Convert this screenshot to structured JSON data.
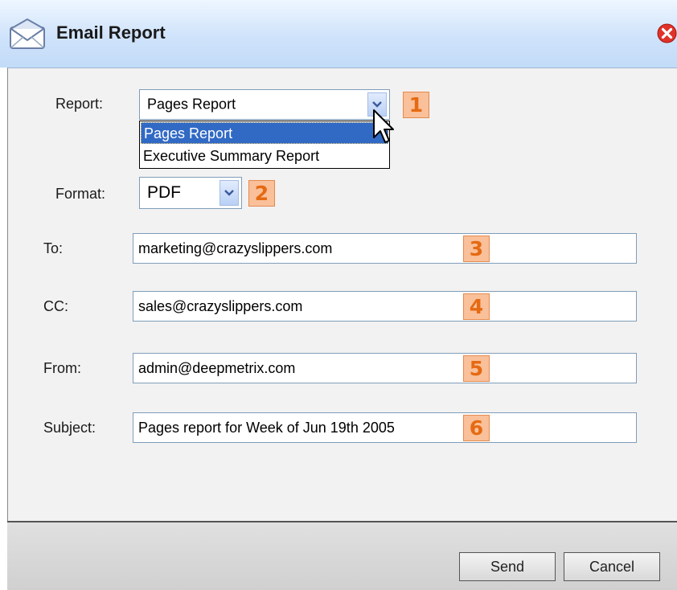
{
  "window": {
    "title": "Email Report"
  },
  "fields": {
    "report": {
      "label": "Report:",
      "value": "Pages Report",
      "options": [
        "Pages Report",
        "Executive Summary Report"
      ],
      "badge": "1"
    },
    "format": {
      "label": "Format:",
      "value": "PDF",
      "badge": "2"
    },
    "to": {
      "label": "To:",
      "value": "marketing@crazyslippers.com",
      "badge": "3"
    },
    "cc": {
      "label": "CC:",
      "value": "sales@crazyslippers.com",
      "badge": "4"
    },
    "from": {
      "label": "From:",
      "value": "admin@deepmetrix.com",
      "badge": "5"
    },
    "subject": {
      "label": "Subject:",
      "value": "Pages report for Week of Jun 19th 2005",
      "badge": "6"
    }
  },
  "buttons": {
    "send": "Send",
    "cancel": "Cancel"
  },
  "colors": {
    "badge_fill": "#f9c09a",
    "badge_text": "#e56a12",
    "selection": "#316ac5",
    "title_bar": "#cfe3fb"
  }
}
